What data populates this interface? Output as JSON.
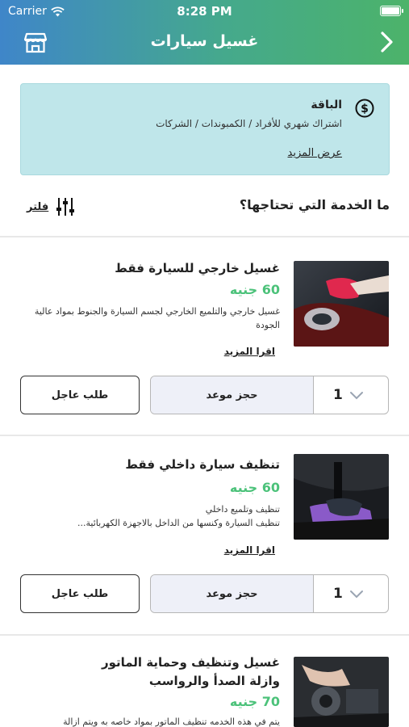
{
  "status_bar": {
    "carrier": "Carrier",
    "time": "8:28 PM"
  },
  "nav": {
    "title": "غسيل سيارات"
  },
  "package": {
    "title": "الباقة",
    "subtitle": "اشتراك شهري للأفراد / الكمبوندات / الشركات",
    "more_link": "عرض المزيد"
  },
  "question": "ما الخدمة التي تحتاجها؟",
  "filter": {
    "label": "فلتر"
  },
  "services": [
    {
      "title": "غسيل خارجي للسيارة فقط",
      "price": "60 جنيه",
      "description": "غسيل خارجي والتلميع الخارجي لجسم السيارة والجنوط بمواد عالية الجودة",
      "more": "اقرا المزيد",
      "book_label": "حجز موعد",
      "quantity": "1",
      "urgent_label": "طلب عاجل"
    },
    {
      "title": "تنظيف سيارة داخلي فقط",
      "price": "60 جنيه",
      "description": "تنظيف وتلميع داخلي\nتنظيف السيارة وكنسها من الداخل بالاجهزة الكهربائية...",
      "more": "اقرا المزيد",
      "book_label": "حجز موعد",
      "quantity": "1",
      "urgent_label": "طلب عاجل"
    },
    {
      "title": "غسيل وتنظيف وحماية الماتور وازلة الصدأ والرواسب",
      "price": "70 جنيه",
      "description": "يتم في هذه الخدمه تنظيف الماتور بمواد خاصه به ويتم ازالة"
    }
  ],
  "colors": {
    "header_start": "#3f86c9",
    "header_end": "#4cb36a",
    "package_bg": "#bfe6ea",
    "price": "#4cc27a"
  },
  "icons": {
    "nav_left": "store-icon",
    "nav_right": "chevron-right-icon",
    "package": "dollar-icon",
    "filter": "sliders-icon"
  }
}
